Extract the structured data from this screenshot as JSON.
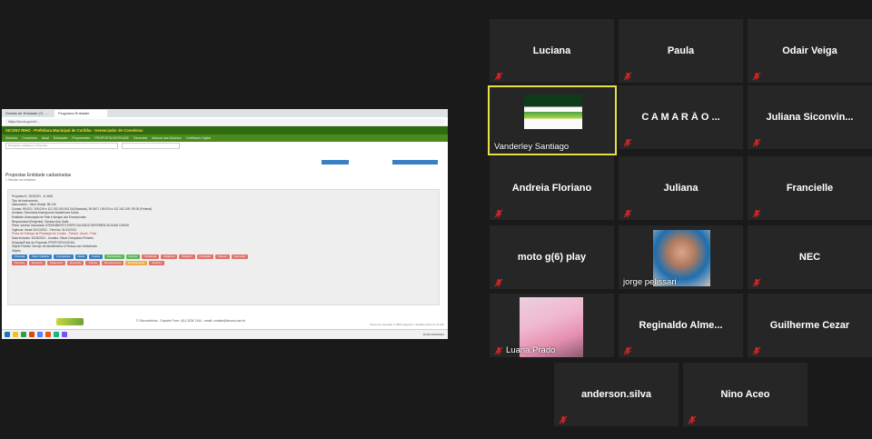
{
  "participants": [
    {
      "name": "Luciana",
      "muted": true
    },
    {
      "name": "Paula",
      "muted": true
    },
    {
      "name": "Odair Veiga",
      "muted": true
    },
    {
      "name": "Vanderley Santiago",
      "muted": false,
      "video": true,
      "speaking": true
    },
    {
      "name": "C A M A R Ã O ...",
      "muted": true
    },
    {
      "name": "Juliana  Siconvin...",
      "muted": true
    },
    {
      "name": "Andreia Floriano",
      "muted": true
    },
    {
      "name": "Juliana",
      "muted": true
    },
    {
      "name": "Francielle",
      "muted": true
    },
    {
      "name": "moto g(6) play",
      "muted": true
    },
    {
      "name": "jorge pelissari",
      "muted": false,
      "video": true
    },
    {
      "name": "NEC",
      "muted": true
    },
    {
      "name": "Luana Prado",
      "muted": true,
      "video": true
    },
    {
      "name": "Reginaldo  Alme...",
      "muted": true
    },
    {
      "name": "Guilherme Cezar",
      "muted": true
    },
    {
      "name": "anderson.silva",
      "muted": true
    },
    {
      "name": "Nino Aceo",
      "muted": true
    }
  ],
  "share": {
    "tabs": [
      "Gestão de Entidade (7) - ...",
      "Programa Entidade"
    ],
    "url": "https://siconv.gov.br/...",
    "app_title": "SICONV RIHO - Prefeitura Municipal de Curitiba - Gerenciador de Convênios",
    "nav": [
      "Módulos",
      "Convênios",
      "Atual",
      "Entidades",
      "Proponentes",
      "PROPOSTA ENTIDADE",
      "Gerenciar",
      "Manual dos Módulos",
      "Certificado Digital"
    ],
    "search_placeholder": "Pesquisar entidade ou Proposta",
    "page_title": "Propostas Entidade cadastradas",
    "page_subtitle": "1 Seleção de entidades",
    "details": [
      "Proposta N.: 003/2021 - in 4616",
      "Tipo de Instrumento:",
      "Instrumento - Valor Global: 98.134",
      "Contas: 99.523 / 105.019 e 112.152.105.924.26 (Estadual), 99.567 / 105.019 e 112.152.105 / 99.00 (Federal)",
      "Unidade: Secretaria Municipal de Assistência Social",
      "Entidade: Associação de Pais e Amigos dos Excepcionais",
      "Responsável (Entgente): Gestora Ana Gatto",
      "Plano Jurídico Associado: ATENDIMENTO ESPECIALIZADO REFERÊNCIA SUAS CNEAS",
      "Vigência: Inicial 01/01/2021 - Término: 31/12/2021",
      "Prazo de Entrega da Prestação de Contas - Parcial - Anual - Final",
      "Data Inclusão: 15/03/2021 - Usuário: Vilson Gonçalves Pinheiro",
      "Situação/Fase da Proposta: PROPOSTA INICIAL",
      "Objeto Padrão: Serviço de Atendimento à Pessoa com Deficiência",
      "Objeto:"
    ],
    "badges_row1": [
      "Proposta",
      "Plano Trabalho",
      "Cronograma",
      "Metas",
      "Custos",
      "Documentos",
      "Anexos"
    ],
    "badges_row2": [
      "Pendência",
      "Diligência",
      "Relatório",
      "Prestação",
      "Parecer",
      "Aprovado"
    ],
    "badges_row3": [
      "Parcelas",
      "Empenho",
      "Pagamento",
      "Execução",
      "Vistoria",
      "Monitoramento",
      "Encerramento"
    ],
    "badges_row4": [
      "Histórico"
    ],
    "footer_text": "© Sicconvênios - Suporte Fone: (41) 3234-7444 - email: contato@siconv.com.br",
    "footer_right": "Tempo de execução: 0.3916 segundos / Sessão expira em 21 Min",
    "taskbar_clock": "15:39 15/03/2021"
  },
  "colors": {
    "tile_bg": "#262626",
    "active_border": "#e8e04a",
    "mic_muted": "#e02424",
    "app_header": "#2f6b10"
  }
}
